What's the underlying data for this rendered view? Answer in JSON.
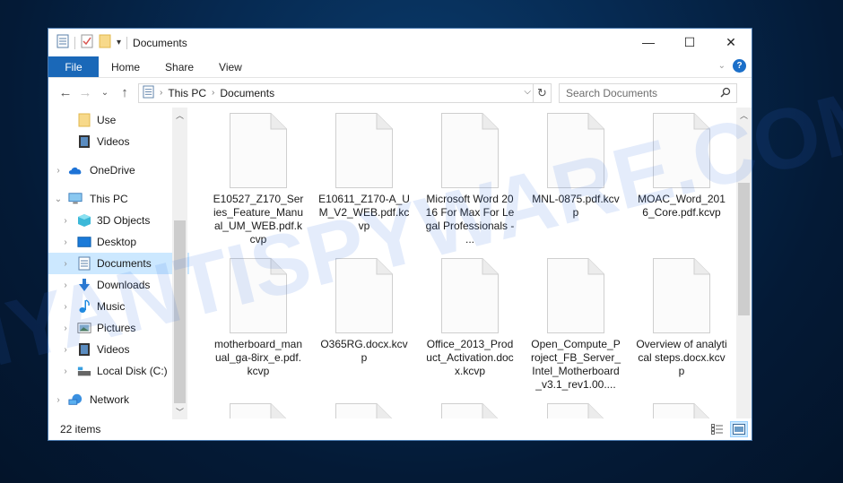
{
  "window": {
    "title": "Documents",
    "controls": {
      "minimize": "—",
      "maximize": "☐",
      "close": "✕"
    }
  },
  "ribbon": {
    "tabs": [
      {
        "label": "File"
      },
      {
        "label": "Home"
      },
      {
        "label": "Share"
      },
      {
        "label": "View"
      }
    ],
    "help_label": "?"
  },
  "navigation": {
    "back": "←",
    "forward": "→",
    "recent": "⌄",
    "up": "↑",
    "breadcrumb": [
      "This PC",
      "Documents"
    ],
    "refresh": "↻",
    "search_placeholder": "Search Documents"
  },
  "sidebar": {
    "items": [
      {
        "label": "Use",
        "icon": "folder-icon",
        "level": 1
      },
      {
        "label": "Videos",
        "icon": "videos-icon",
        "level": 1
      },
      {
        "label": "OneDrive",
        "icon": "onedrive-icon",
        "level": 0
      },
      {
        "label": "This PC",
        "icon": "this-pc-icon",
        "level": 0,
        "expanded": true
      },
      {
        "label": "3D Objects",
        "icon": "3d-objects-icon",
        "level": 1
      },
      {
        "label": "Desktop",
        "icon": "desktop-icon",
        "level": 1
      },
      {
        "label": "Documents",
        "icon": "documents-icon",
        "level": 1,
        "selected": true
      },
      {
        "label": "Downloads",
        "icon": "downloads-icon",
        "level": 1
      },
      {
        "label": "Music",
        "icon": "music-icon",
        "level": 1
      },
      {
        "label": "Pictures",
        "icon": "pictures-icon",
        "level": 1
      },
      {
        "label": "Videos",
        "icon": "videos-icon",
        "level": 1
      },
      {
        "label": "Local Disk (C:)",
        "icon": "local-disk-icon",
        "level": 1
      },
      {
        "label": "Network",
        "icon": "network-icon",
        "level": 0
      }
    ]
  },
  "files": [
    {
      "name": "E10527_Z170_Series_Feature_Manual_UM_WEB.pdf.kcvp"
    },
    {
      "name": "E10611_Z170-A_UM_V2_WEB.pdf.kcvp"
    },
    {
      "name": "Microsoft Word 2016 For Max For Legal Professionals - ..."
    },
    {
      "name": "MNL-0875.pdf.kcvp"
    },
    {
      "name": "MOAC_Word_2016_Core.pdf.kcvp"
    },
    {
      "name": "motherboard_manual_ga-8irx_e.pdf.kcvp"
    },
    {
      "name": "O365RG.docx.kcvp"
    },
    {
      "name": "Office_2013_Product_Activation.docx.kcvp"
    },
    {
      "name": "Open_Compute_Project_FB_Server_Intel_Motherboard_v3.1_rev1.00...."
    },
    {
      "name": "Overview of analytical steps.docx.kcvp"
    },
    {
      "name": ""
    },
    {
      "name": ""
    },
    {
      "name": ""
    },
    {
      "name": ""
    },
    {
      "name": ""
    }
  ],
  "status": {
    "item_count": "22 items"
  },
  "watermark": "MYANTISPYWARE.COM",
  "colors": {
    "file_tab": "#1a68b8",
    "selection": "#cce8ff",
    "help": "#1b6fc9"
  }
}
